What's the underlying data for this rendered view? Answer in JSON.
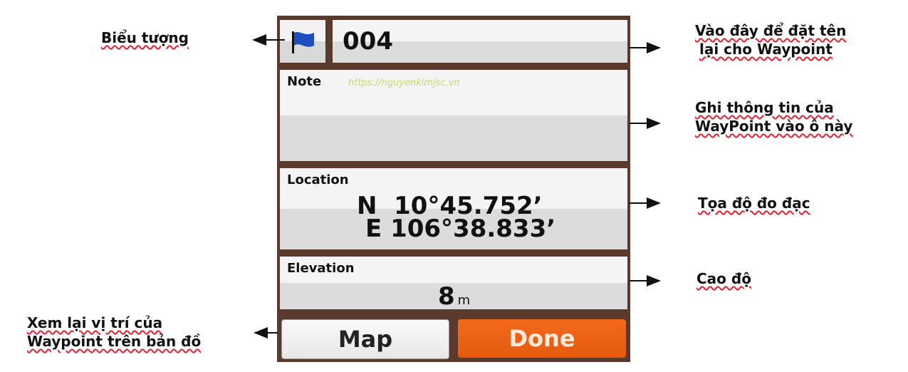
{
  "waypoint": {
    "name": "004",
    "note_label": "Note",
    "watermark": "https://nguyenkimjsc.vn",
    "location_label": "Location",
    "lat": "N  10°45.752’",
    "lon": "E 106°38.833’",
    "elevation_label": "Elevation",
    "elevation_value": "8",
    "elevation_unit": "m",
    "flag_color": "#1e4fc0"
  },
  "buttons": {
    "map": "Map",
    "done": "Done",
    "done_color": "#f36a1c"
  },
  "annotations": {
    "icon": "Biểu tượng",
    "rename_1": "Vào đây để đặt tên",
    "rename_2": "lại cho Waypoint",
    "note_1": "Ghi thông tin của",
    "note_2": "WayPoint vào ô này",
    "coords": "Tọa độ đo đạc",
    "elevation": "Cao độ",
    "map_1": "Xem lại vị trí của",
    "map_2": "Waypoint trên bản đồ"
  }
}
